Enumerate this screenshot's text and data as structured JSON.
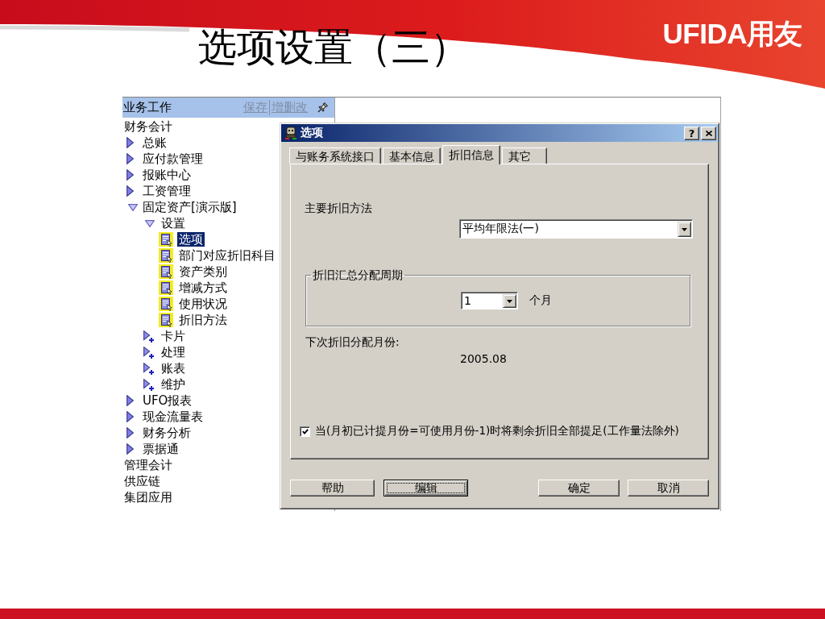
{
  "slide": {
    "title": "选项设置（三）",
    "logo": "UFIDA用友"
  },
  "navigator": {
    "header": {
      "title": "业务工作",
      "links": [
        "保存",
        "增删改"
      ]
    },
    "tree": [
      {
        "label": "财务会计",
        "kind": "category",
        "selected": false,
        "children": [
          {
            "label": "总账",
            "kind": "module",
            "expanded": false,
            "selected": false
          },
          {
            "label": "应付款管理",
            "kind": "module",
            "expanded": false,
            "selected": false
          },
          {
            "label": "报账中心",
            "kind": "module",
            "expanded": false,
            "selected": false
          },
          {
            "label": "工资管理",
            "kind": "module",
            "expanded": false,
            "selected": false
          },
          {
            "label": "固定资产[演示版]",
            "kind": "module",
            "expanded": true,
            "selected": false,
            "children": [
              {
                "label": "设置",
                "kind": "module",
                "expanded": true,
                "selected": false,
                "children": [
                  {
                    "label": "选项",
                    "kind": "function",
                    "selected": true
                  },
                  {
                    "label": "部门对应折旧科目",
                    "kind": "function",
                    "selected": false
                  },
                  {
                    "label": "资产类别",
                    "kind": "function",
                    "selected": false
                  },
                  {
                    "label": "增减方式",
                    "kind": "function",
                    "selected": false
                  },
                  {
                    "label": "使用状况",
                    "kind": "function",
                    "selected": false
                  },
                  {
                    "label": "折旧方法",
                    "kind": "function",
                    "selected": false
                  }
                ]
              },
              {
                "label": "卡片",
                "kind": "submodule",
                "expanded": false,
                "selected": false
              },
              {
                "label": "处理",
                "kind": "submodule",
                "expanded": false,
                "selected": false
              },
              {
                "label": "账表",
                "kind": "submodule",
                "expanded": false,
                "selected": false
              },
              {
                "label": "维护",
                "kind": "submodule",
                "expanded": false,
                "selected": false
              }
            ]
          },
          {
            "label": "UFO报表",
            "kind": "module",
            "expanded": false,
            "selected": false
          },
          {
            "label": "现金流量表",
            "kind": "module",
            "expanded": false,
            "selected": false
          },
          {
            "label": "财务分析",
            "kind": "module",
            "expanded": false,
            "selected": false
          },
          {
            "label": "票据通",
            "kind": "module",
            "expanded": false,
            "selected": false
          }
        ]
      },
      {
        "label": "管理会计",
        "kind": "category",
        "selected": false
      },
      {
        "label": "供应链",
        "kind": "category",
        "selected": false
      },
      {
        "label": "集团应用",
        "kind": "category",
        "selected": false
      }
    ]
  },
  "dialog": {
    "title": "选项",
    "help_button": "?",
    "tabs": [
      {
        "label": "与账务系统接口",
        "selected": false
      },
      {
        "label": "基本信息",
        "selected": false
      },
      {
        "label": "折旧信息",
        "selected": true
      },
      {
        "label": "其它",
        "selected": false
      }
    ],
    "panel": {
      "depreciation_method": {
        "label": "主要折旧方法",
        "value": "平均年限法(一)"
      },
      "allocation_period": {
        "legend": "折旧汇总分配周期",
        "value": "1",
        "unit": "个月"
      },
      "next_allocation": {
        "label": "下次折旧分配月份:",
        "value": "2005.08"
      },
      "full_provision": {
        "checked": true,
        "label": "当(月初已计提月份=可使用月份-1)时将剩余折旧全部提足(工作量法除外)"
      }
    },
    "left_buttons": [
      {
        "label": "帮助",
        "focused": false
      },
      {
        "label": "编辑",
        "focused": true
      }
    ],
    "right_buttons": [
      {
        "label": "确定",
        "focused": false
      },
      {
        "label": "取消",
        "focused": false
      }
    ]
  }
}
